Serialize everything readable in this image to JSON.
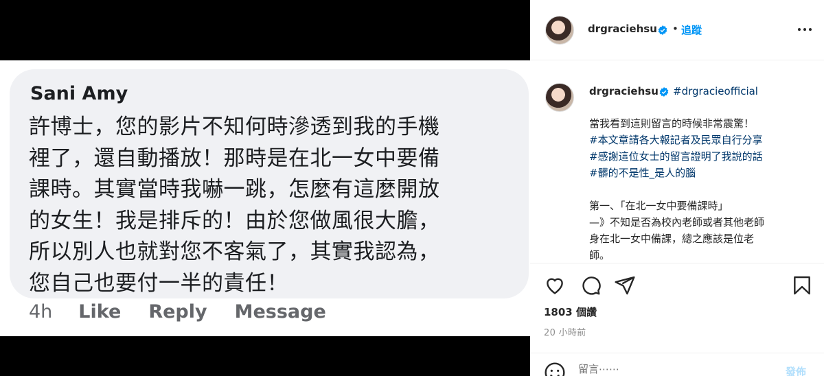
{
  "media": {
    "comment_author": "Sani Amy",
    "comment_lines": [
      "許博士，您的影片不知何時滲透到我的手機",
      "裡了，還自動播放！那時是在北一女中要備",
      "課時。其實當時我嚇一跳，怎麼有這麼開放",
      "的女生！我是排斥的！由於您做風很大膽，",
      "所以別人也就對您不客氣了，其實我認為，",
      "您自己也要付一半的責任！"
    ],
    "time": "4h",
    "actions": [
      "Like",
      "Reply",
      "Message"
    ]
  },
  "header": {
    "username": "drgraciehsu",
    "separator": "•",
    "follow_label": "追蹤"
  },
  "caption": {
    "username": "drgraciehsu",
    "tag": "#drgracieofficial",
    "line1": "當我看到這則留言的時候非常震驚！",
    "hashtags": [
      "#本文章請各大報記者及民眾自行分享",
      "#感謝這位女士的留言證明了我說的話",
      "#髒的不是性_是人的腦"
    ],
    "para_lines": [
      "第一、「在北一女中要備課時」",
      "—》不知是否為校內老師或者其他老師",
      "身在北一女中備課，總之應該是位老",
      "師。"
    ]
  },
  "stats": {
    "likes": "1803 個讚",
    "time_ago": "20 小時前"
  },
  "comment": {
    "placeholder": "留言⋯⋯",
    "post_label": "發佈"
  },
  "icons": {
    "heart": "heart-icon",
    "comment": "comment-icon",
    "share": "share-icon",
    "save": "bookmark-icon",
    "more": "more-options-icon",
    "emoji": "emoji-icon",
    "verified": "verified-badge-icon"
  },
  "colors": {
    "link_blue": "#0095f6",
    "hashtag": "#00376b",
    "verified": "#0095f6",
    "bubble_bg": "#f0f1f4"
  }
}
